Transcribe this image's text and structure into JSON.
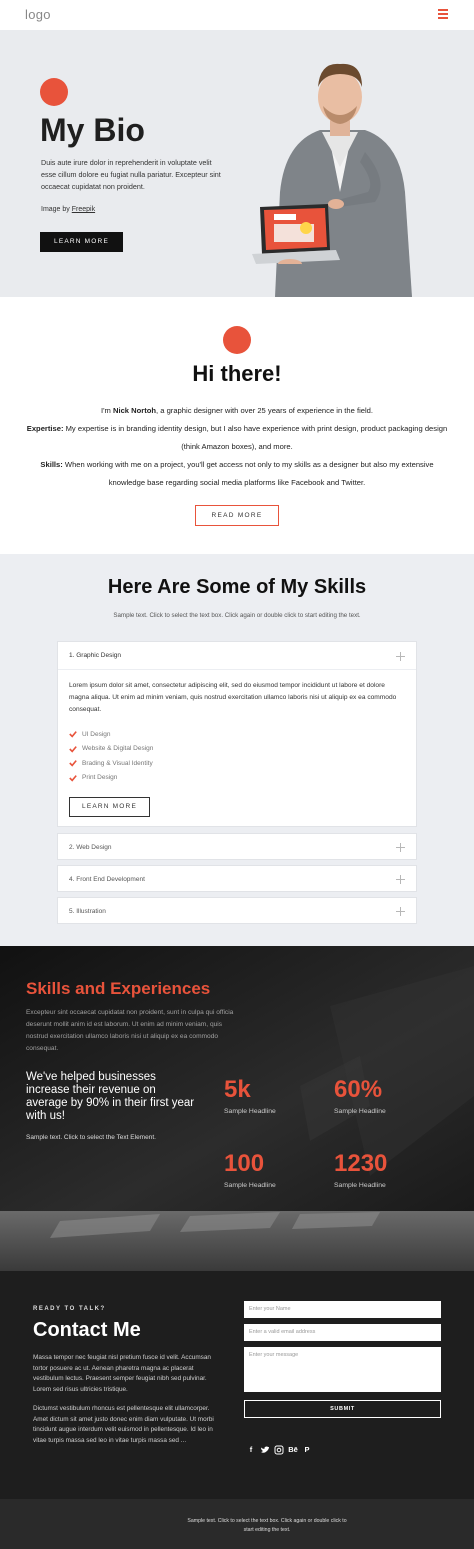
{
  "header": {
    "logo": "logo",
    "menu_icon": "hamburger-icon"
  },
  "hero": {
    "title": "My Bio",
    "text": "Duis aute irure dolor in reprehenderit in voluptate velit esse cillum dolore eu fugiat nulla pariatur. Excepteur sint occaecat cupidatat non proident.",
    "credit_prefix": "Image by ",
    "credit_link": "Freepik",
    "button": "LEARN MORE"
  },
  "intro": {
    "title": "Hi there!",
    "line1_pre": "I'm ",
    "line1_name": "Nick Nortoh",
    "line1_post": ", a graphic designer with over 25 years of experience in the field.",
    "expertise_label": "Expertise:",
    "expertise_text": " My expertise is in branding identity design, but I also have experience with print design, product packaging design (think Amazon boxes), and more.",
    "skills_label": "Skills:",
    "skills_text": " When working with me on a project, you'll get access not only to my skills as a designer but also my extensive knowledge base regarding social media platforms like Facebook and Twitter.",
    "button": "READ MORE"
  },
  "skills": {
    "title": "Here Are Some of My Skills",
    "subtitle": "Sample text. Click to select the text box. Click again or double click to start editing the text.",
    "open_item": {
      "title": "1. Graphic Design",
      "text": "Lorem ipsum dolor sit amet, consectetur adipiscing elit, sed do eiusmod tempor incididunt ut labore et dolore magna aliqua. Ut enim ad minim veniam, quis nostrud exercitation ullamco laboris nisi ut aliquip ex ea commodo consequat.",
      "checks": [
        "UI Design",
        "Website & Digital Design",
        "Brading & Visual Identity",
        "Print Design"
      ],
      "button": "LEARN MORE"
    },
    "closed_items": [
      "2. Web Design",
      "4. Front End Development",
      "5. Illustration"
    ]
  },
  "experience": {
    "title": "Skills and Experiences",
    "text": "Excepteur sint occaecat cupidatat non proident, sunt in culpa qui officia deserunt mollit anim id est laborum. Ut enim ad minim veniam, quis nostrud exercitation ullamco laboris nisi ut aliquip ex ea commodo consequat.",
    "big_text": "We've helped businesses increase their revenue on average by 90% in their first year with us!",
    "small_text": "Sample text. Click to select the Text Element.",
    "stats": [
      {
        "value": "5k",
        "label": "Sample Headline"
      },
      {
        "value": "60%",
        "label": "Sample Headline"
      },
      {
        "value": "100",
        "label": "Sample Headline"
      },
      {
        "value": "1230",
        "label": "Sample Headline"
      }
    ],
    "accent_color": "#e8533b"
  },
  "contact": {
    "eyebrow": "READY TO TALK?",
    "title": "Contact Me",
    "p1": "Massa tempor nec feugiat nisl pretium fusce id velit. Accumsan tortor posuere ac ut. Aenean pharetra magna ac placerat vestibulum lectus. Praesent semper feugiat nibh sed pulvinar. Lorem sed risus ultricies tristique.",
    "p2": "Dictumst vestibulum rhoncus est pellentesque elit ullamcorper. Amet dictum sit amet justo donec enim diam vulputate. Ut morbi tincidunt augue interdum velit euismod in pellentesque. Id leo in vitae turpis massa sed leo in vitae turpis massa sed ...",
    "name_placeholder": "Enter your Name",
    "email_placeholder": "Enter a valid email address",
    "message_placeholder": "Enter your message",
    "submit": "SUBMIT",
    "socials": [
      "f",
      "t",
      "o",
      "Bē",
      "P"
    ]
  },
  "footer": {
    "text": "Sample text. Click to select the text box. Click again or double click to start editing the text."
  }
}
